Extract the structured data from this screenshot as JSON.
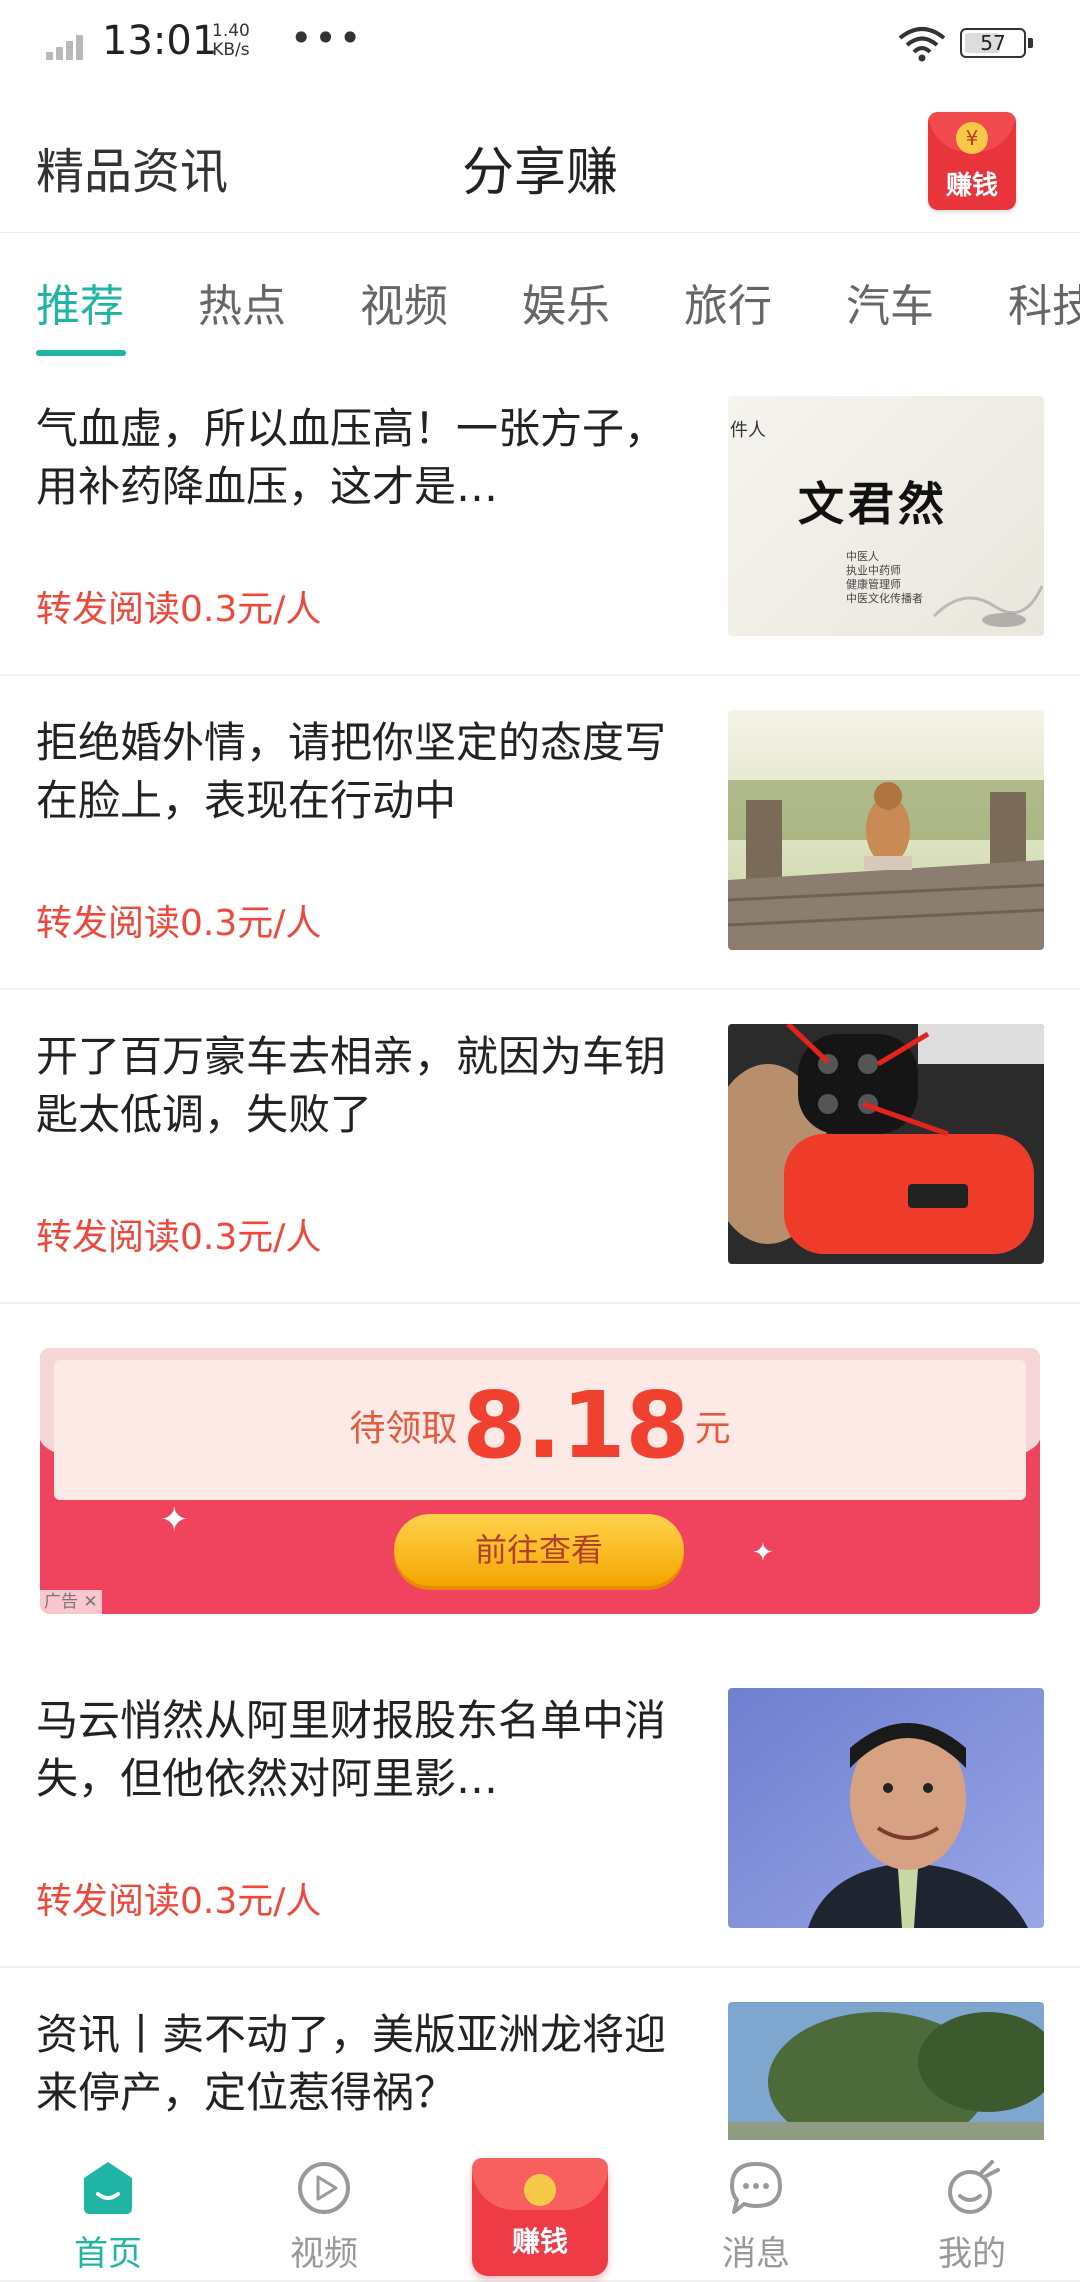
{
  "status_bar": {
    "time": "13:01",
    "net_speed_value": "1.40",
    "net_speed_unit": "KB/s",
    "more": "•••",
    "battery": "57"
  },
  "header": {
    "left_title": "精品资讯",
    "title": "分享赚",
    "earn_badge_label": "赚钱",
    "earn_badge_symbol": "¥"
  },
  "tabs": [
    {
      "label": "推荐",
      "active": true
    },
    {
      "label": "热点"
    },
    {
      "label": "视频"
    },
    {
      "label": "娱乐"
    },
    {
      "label": "旅行"
    },
    {
      "label": "汽车"
    },
    {
      "label": "科技"
    }
  ],
  "articles": [
    {
      "title": "气血虚，所以血压高！一张方子，用补药降血压，这才是…",
      "reward": "转发阅读0.3元/人",
      "thumb_text_big": "文君然",
      "thumb_text_corner": "件人",
      "thumb_text_lines": [
        "中医人",
        "执业中药师",
        "健康管理师",
        "中医文化传播者"
      ]
    },
    {
      "title": "拒绝婚外情，请把你坚定的态度写在脸上，表现在行动中",
      "reward": "转发阅读0.3元/人"
    },
    {
      "title": "开了百万豪车去相亲，就因为车钥匙太低调，失败了",
      "reward": "转发阅读0.3元/人"
    },
    {
      "title": "马云悄然从阿里财报股东名单中消失，但他依然对阿里影…",
      "reward": "转发阅读0.3元/人"
    },
    {
      "title": "资讯丨卖不动了，美版亚洲龙将迎来停产，定位惹得祸？",
      "reward": ""
    }
  ],
  "ad": {
    "pending_label": "待领取",
    "amount": "8.18",
    "unit": "元",
    "button": "前往查看",
    "tag": "广告 ✕"
  },
  "bottom_nav": {
    "home": "首页",
    "video": "视频",
    "earn": "赚钱",
    "messages": "消息",
    "mine": "我的"
  },
  "colors": {
    "accent": "#1fb4a4",
    "reward": "#f0473a",
    "earn_red": "#ee3b46"
  }
}
